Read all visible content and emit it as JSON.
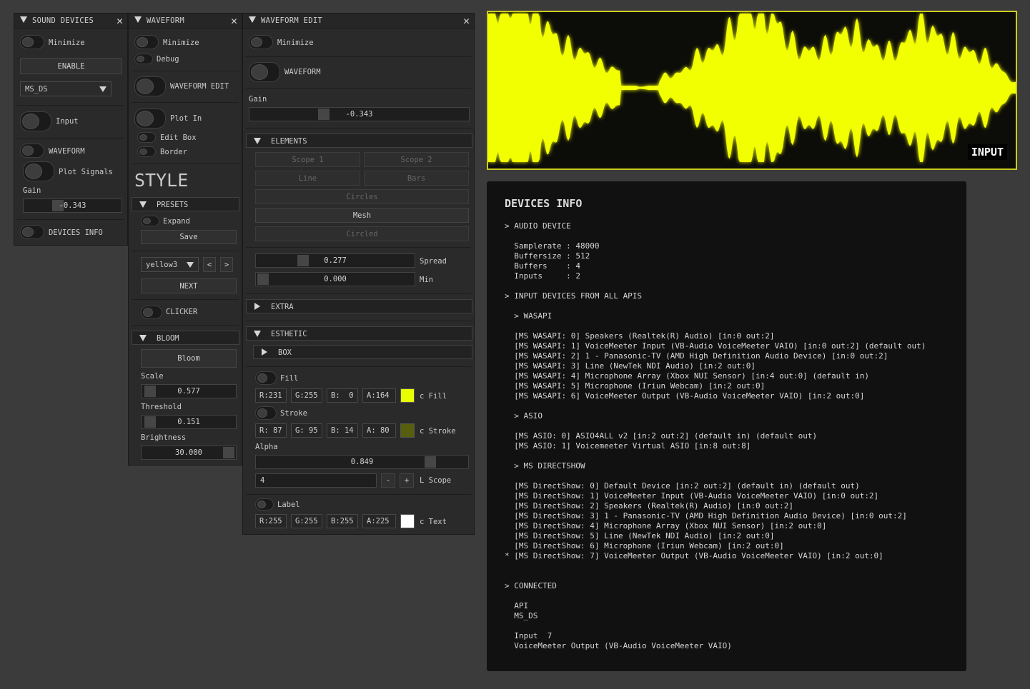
{
  "sound_devices": {
    "title": "SOUND DEVICES",
    "minimize": "Minimize",
    "enable": "ENABLE",
    "device_select": "MS_DS",
    "input": "Input",
    "waveform": "WAVEFORM",
    "plot_signals": "Plot Signals",
    "gain_label": "Gain",
    "gain_value": "-0.343",
    "devices_info": "DEVICES INFO"
  },
  "waveform": {
    "title": "WAVEFORM",
    "minimize": "Minimize",
    "debug": "Debug",
    "waveform_edit": "WAVEFORM EDIT",
    "plot_in": "Plot In",
    "edit_box": "Edit Box",
    "border": "Border",
    "style_heading": "STYLE",
    "presets": "PRESETS",
    "expand": "Expand",
    "save": "Save",
    "preset_select": "yellow3",
    "prev": "<",
    "next_arrow": ">",
    "next": "NEXT",
    "clicker": "CLICKER",
    "bloom_section": "BLOOM",
    "bloom_button": "Bloom",
    "scale_label": "Scale",
    "scale_value": "0.577",
    "threshold_label": "Threshold",
    "threshold_value": "0.151",
    "brightness_label": "Brightness",
    "brightness_value": "30.000"
  },
  "waveform_edit": {
    "title": "WAVEFORM EDIT",
    "minimize": "Minimize",
    "waveform": "WAVEFORM",
    "gain_label": "Gain",
    "gain_value": "-0.343",
    "elements": "ELEMENTS",
    "scope1": "Scope 1",
    "scope2": "Scope 2",
    "line": "Line",
    "bars": "Bars",
    "circles": "Circles",
    "mesh": "Mesh",
    "circled": "Circled",
    "spread_value": "0.277",
    "spread_label": "Spread",
    "min_value": "0.000",
    "min_label": "Min",
    "extra": "EXTRA",
    "esthetic": "ESTHETIC",
    "box": "BOX",
    "fill": "Fill",
    "fill_r": "R:231",
    "fill_g": "G:255",
    "fill_b": "B:  0",
    "fill_a": "A:164",
    "fill_color_label": "c Fill",
    "stroke": "Stroke",
    "stroke_r": "R: 87",
    "stroke_g": "G: 95",
    "stroke_b": "B: 14",
    "stroke_a": "A: 80",
    "stroke_color_label": "c Stroke",
    "alpha_label": "Alpha",
    "alpha_value": "0.849",
    "lscope_value": "4",
    "minus": "-",
    "plus": "+",
    "lscope_label": "L Scope",
    "label": "Label",
    "text_r": "R:255",
    "text_g": "G:255",
    "text_b": "B:255",
    "text_a": "A:225",
    "text_color_label": "c Text"
  },
  "colors": {
    "fill": "#e7ff00",
    "stroke": "#575f0e",
    "text": "#ffffff",
    "waveform": "#f2ff00"
  },
  "scope": {
    "label": "INPUT"
  },
  "devices_info": {
    "title": "DEVICES INFO",
    "lines": [
      "> AUDIO DEVICE",
      "",
      "  Samplerate : 48000",
      "  Buffersize : 512",
      "  Buffers    : 4",
      "  Inputs     : 2",
      "",
      "> INPUT DEVICES FROM ALL APIS",
      "",
      "  > WASAPI",
      "",
      "  [MS WASAPI: 0] Speakers (Realtek(R) Audio) [in:0 out:2]",
      "  [MS WASAPI: 1] VoiceMeeter Input (VB-Audio VoiceMeeter VAIO) [in:0 out:2] (default out)",
      "  [MS WASAPI: 2] 1 - Panasonic-TV (AMD High Definition Audio Device) [in:0 out:2]",
      "  [MS WASAPI: 3] Line (NewTek NDI Audio) [in:2 out:0]",
      "  [MS WASAPI: 4] Microphone Array (Xbox NUI Sensor) [in:4 out:0] (default in)",
      "  [MS WASAPI: 5] Microphone (Iriun Webcam) [in:2 out:0]",
      "  [MS WASAPI: 6] VoiceMeeter Output (VB-Audio VoiceMeeter VAIO) [in:2 out:0]",
      "",
      "  > ASIO",
      "",
      "  [MS ASIO: 0] ASIO4ALL v2 [in:2 out:2] (default in) (default out)",
      "  [MS ASIO: 1] Voicemeeter Virtual ASIO [in:8 out:8]",
      "",
      "  > MS DIRECTSHOW",
      "",
      "  [MS DirectShow: 0] Default Device [in:2 out:2] (default in) (default out)",
      "  [MS DirectShow: 1] VoiceMeeter Input (VB-Audio VoiceMeeter VAIO) [in:0 out:2]",
      "  [MS DirectShow: 2] Speakers (Realtek(R) Audio) [in:0 out:2]",
      "  [MS DirectShow: 3] 1 - Panasonic-TV (AMD High Definition Audio Device) [in:0 out:2]",
      "  [MS DirectShow: 4] Microphone Array (Xbox NUI Sensor) [in:2 out:0]",
      "  [MS DirectShow: 5] Line (NewTek NDI Audio) [in:2 out:0]",
      "  [MS DirectShow: 6] Microphone (Iriun Webcam) [in:2 out:0]",
      "* [MS DirectShow: 7] VoiceMeeter Output (VB-Audio VoiceMeeter VAIO) [in:2 out:0]",
      "",
      "",
      "> CONNECTED",
      "",
      "  API",
      "  MS_DS",
      "",
      "  Input  7",
      "  VoiceMeeter Output (VB-Audio VoiceMeeter VAIO)"
    ]
  }
}
